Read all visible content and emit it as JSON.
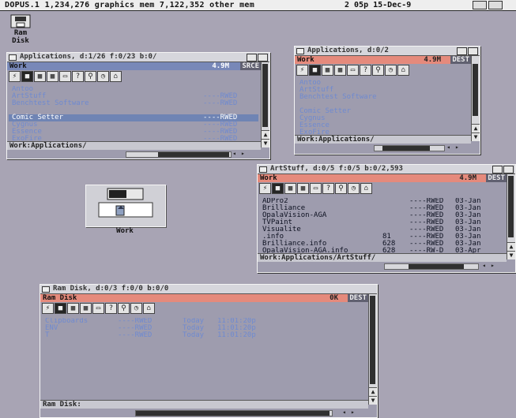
{
  "screen": {
    "title": "DOPUS.1  1,234,276 graphics mem  7,122,352 other mem ",
    "date": "2 05p  15-Dec-9"
  },
  "desktop": {
    "ram_disk_label": "Ram Disk",
    "work_label": "Work"
  },
  "windows": {
    "app1": {
      "title": "Applications, d:1/26 f:0/23 b:0/",
      "path": "Work",
      "right": "4.9M",
      "badge": "SRCE",
      "rows": [
        {
          "name": "Antoo",
          "prot": "",
          "sel": false
        },
        {
          "name": "ArtStuff",
          "prot": "----RWED",
          "sel": false
        },
        {
          "name": "Benchtest Software",
          "prot": "----RWED",
          "sel": false
        },
        {
          "name": "",
          "prot": "",
          "sel": false
        },
        {
          "name": "Comic Setter",
          "prot": "----RWED",
          "sel": true
        },
        {
          "name": "Cygnus",
          "prot": "----RWED",
          "sel": false
        },
        {
          "name": "Essence",
          "prot": "----RWED",
          "sel": false
        },
        {
          "name": "ExoFire",
          "prot": "----RWED",
          "sel": false
        }
      ],
      "bottom": "Work:Applications/"
    },
    "app2": {
      "title": "Applications, d:0/2",
      "path": "Work",
      "right": "4.9M",
      "badge": "DEST",
      "rows": [
        {
          "name": "Antoo",
          "prot": "",
          "sel": false
        },
        {
          "name": "ArtStuff",
          "prot": "",
          "sel": false
        },
        {
          "name": "Benchtest Software",
          "prot": "",
          "sel": false
        },
        {
          "name": "",
          "prot": "",
          "sel": false
        },
        {
          "name": "Comic Setter",
          "prot": "",
          "sel": false
        },
        {
          "name": "Cygnus",
          "prot": "",
          "sel": false
        },
        {
          "name": "Essence",
          "prot": "",
          "sel": false
        },
        {
          "name": "ExoFire",
          "prot": "",
          "sel": false
        }
      ],
      "bottom": "Work:Applications/"
    },
    "art": {
      "title": "ArtStuff, d:0/5 f:0/5 b:0/2,593",
      "path": "Work",
      "right": "4.9M",
      "badge": "DEST",
      "rows": [
        {
          "name": "ADPro2",
          "size": "",
          "prot": "----RWED",
          "date": "03-Jan",
          "sel": false
        },
        {
          "name": "Brilliance",
          "size": "",
          "prot": "----RWED",
          "date": "03-Jan",
          "sel": false
        },
        {
          "name": "OpalaVision-AGA",
          "size": "",
          "prot": "----RWED",
          "date": "03-Jan",
          "sel": false
        },
        {
          "name": "TVPaint",
          "size": "",
          "prot": "----RWED",
          "date": "03-Jan",
          "sel": false
        },
        {
          "name": "Visualite",
          "size": "",
          "prot": "----RWED",
          "date": "03-Jan",
          "sel": false
        },
        {
          "name": ".info",
          "size": "81",
          "prot": "----RWED",
          "date": "03-Jan",
          "sel": false
        },
        {
          "name": "Brilliance.info",
          "size": "628",
          "prot": "----RWED",
          "date": "03-Jan",
          "sel": false
        },
        {
          "name": "OpalaVision-AGA.info",
          "size": "628",
          "prot": "----RW-D",
          "date": "03-Apr",
          "sel": false
        }
      ],
      "bottom": "Work:Applications/ArtStuff/"
    },
    "ram": {
      "title": "Ram Disk, d:0/3 f:0/0 b:0/0",
      "path": "Ram Disk",
      "right": "0K",
      "badge": "DEST",
      "rows": [
        {
          "name": "Clipboards",
          "prot": "----RWED",
          "when": "Today",
          "time": "11:01:20p",
          "sel": false
        },
        {
          "name": "ENV",
          "prot": "----RWED",
          "when": "Today",
          "time": "11:01:20p",
          "sel": false
        },
        {
          "name": "T",
          "prot": "----RWED",
          "when": "Today",
          "time": "11:01:20p",
          "sel": false
        }
      ],
      "bottom": "Ram Disk:"
    }
  },
  "toolbar_icons": [
    "lightning-icon",
    "disk-icon",
    "grid-icon",
    "grid-icon",
    "window-icon",
    "question-icon",
    "magnify-icon",
    "clock-icon",
    "lock-icon"
  ],
  "colors": {
    "accent": "#e58a7c",
    "file_text": "#6f8ad0",
    "dir_text": "#0c1020",
    "selection": "#6f84b4",
    "desktop": "#a8a4b4"
  }
}
